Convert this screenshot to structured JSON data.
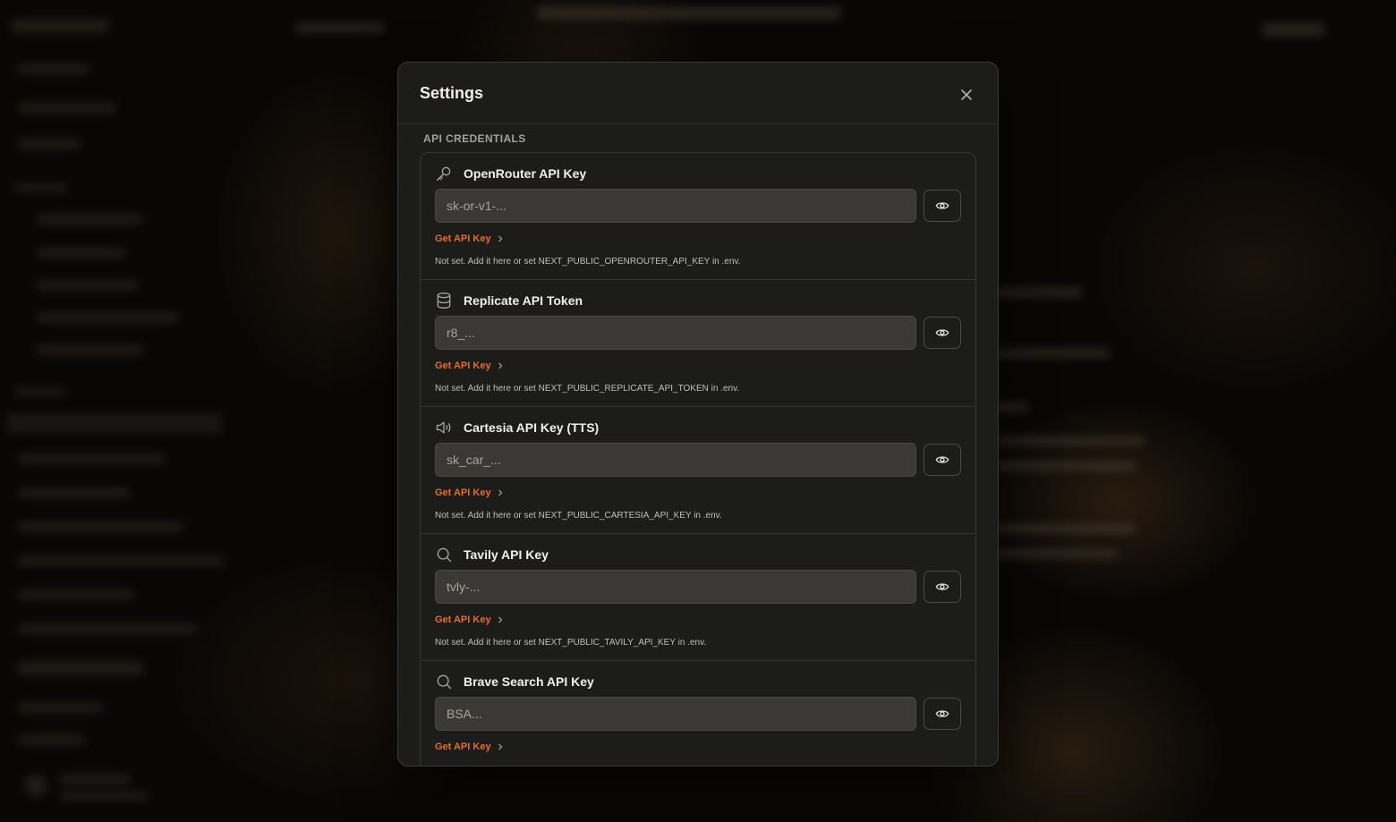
{
  "modal": {
    "title": "Settings",
    "section_label": "API CREDENTIALS",
    "get_key_label": "Get API Key",
    "credentials": [
      {
        "name": "OpenRouter API Key",
        "icon": "key-icon",
        "placeholder": "sk-or-v1-...",
        "note": "Not set. Add it here or set NEXT_PUBLIC_OPENROUTER_API_KEY in .env."
      },
      {
        "name": "Replicate API Token",
        "icon": "database-icon",
        "placeholder": "r8_...",
        "note": "Not set. Add it here or set NEXT_PUBLIC_REPLICATE_API_TOKEN in .env."
      },
      {
        "name": "Cartesia API Key (TTS)",
        "icon": "speaker-icon",
        "placeholder": "sk_car_...",
        "note": "Not set. Add it here or set NEXT_PUBLIC_CARTESIA_API_KEY in .env."
      },
      {
        "name": "Tavily API Key",
        "icon": "search-icon",
        "placeholder": "tvly-...",
        "note": "Not set. Add it here or set NEXT_PUBLIC_TAVILY_API_KEY in .env."
      },
      {
        "name": "Brave Search API Key",
        "icon": "search-icon",
        "placeholder": "BSA...",
        "note": ""
      }
    ]
  },
  "colors": {
    "accent": "#ea6b1f",
    "modal_bg": "#1c1c1b",
    "input_bg": "#3a3935"
  }
}
